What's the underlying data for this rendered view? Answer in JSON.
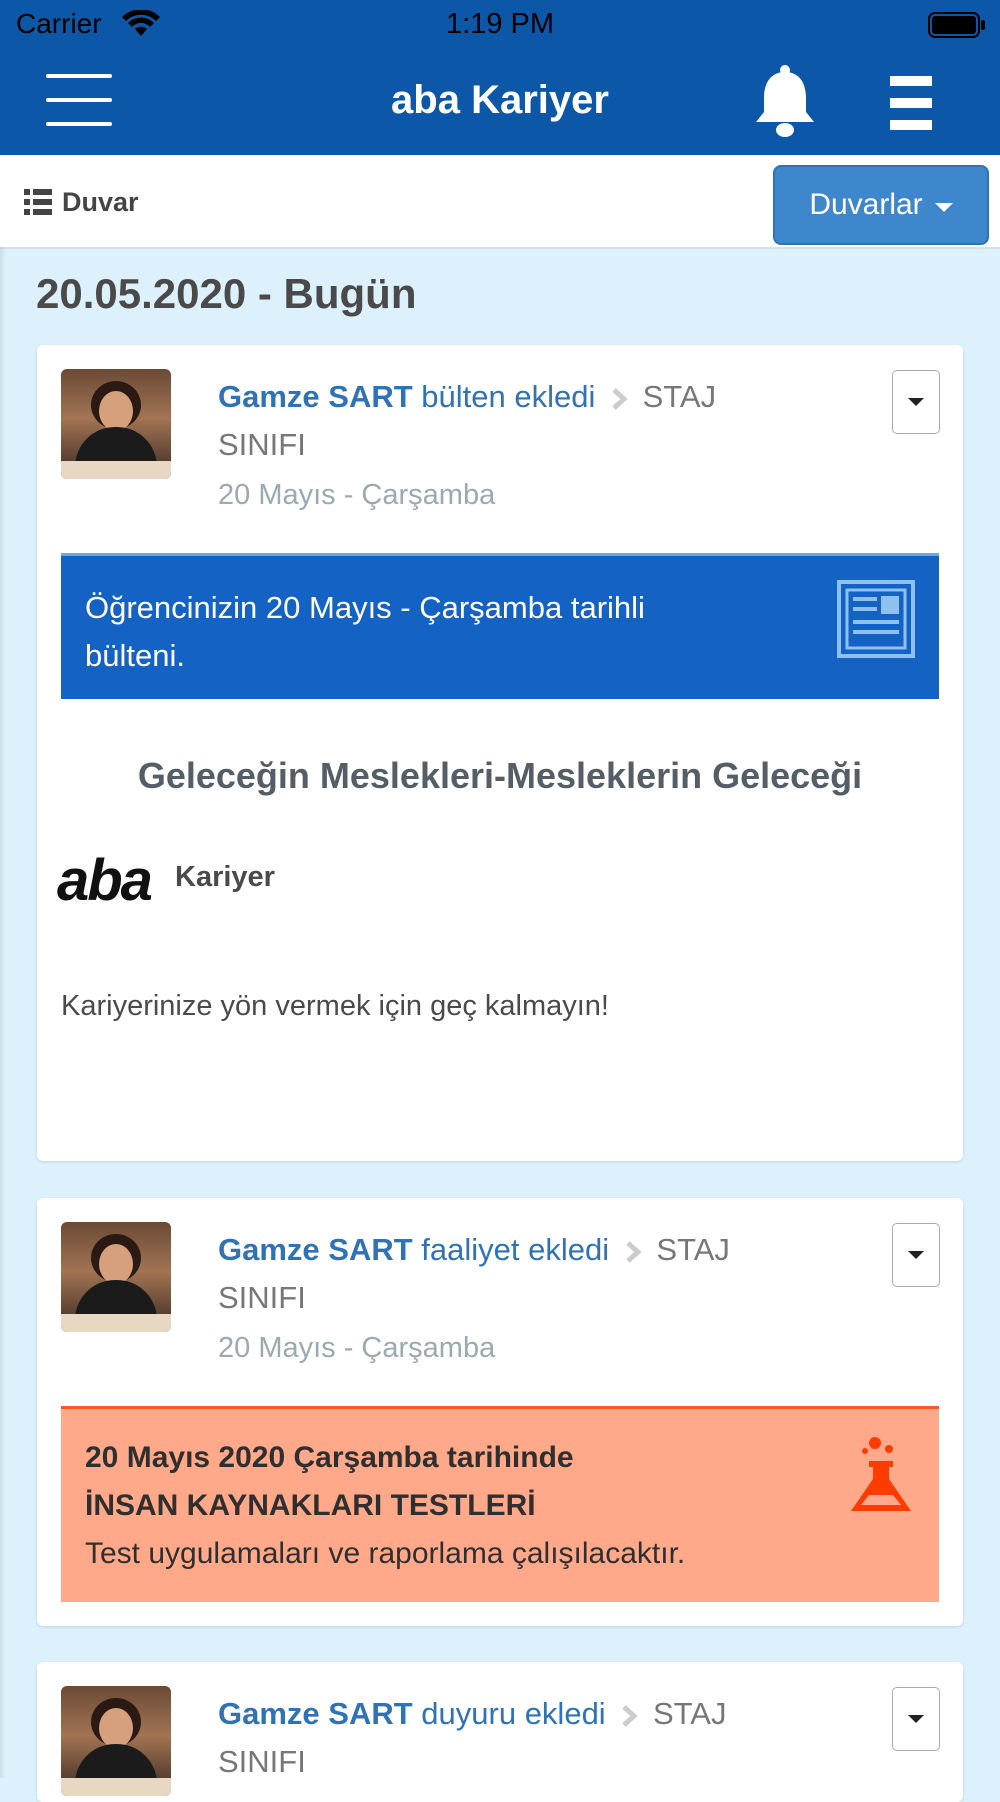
{
  "status_bar": {
    "carrier": "Carrier",
    "time": "1:19 PM"
  },
  "header": {
    "title": "aba Kariyer"
  },
  "toolbar": {
    "label": "Duvar",
    "walls_button": "Duvarlar"
  },
  "date_heading": "20.05.2020 - Bugün",
  "posts": [
    {
      "author": "Gamze SART",
      "action": "bülten ekledi",
      "target": "STAJ SINIFI",
      "date": "20 Mayıs - Çarşamba",
      "banner_text": "Öğrencinizin 20 Mayıs - Çarşamba tarihli bülteni.",
      "newsletter_title": "Geleceğin Meslekleri-Mesleklerin Geleceği",
      "logo_text": "aba",
      "logo_suffix": "Kariyer",
      "body": "Kariyerinize yön vermek için geç kalmayın!"
    },
    {
      "author": "Gamze SART",
      "action": "faaliyet ekledi",
      "target": "STAJ SINIFI",
      "date": "20 Mayıs - Çarşamba",
      "banner_line1": "20 Mayıs 2020 Çarşamba tarihinde",
      "banner_line2": "İNSAN KAYNAKLARI TESTLERİ",
      "banner_line3": "Test uygulamaları ve raporlama çalışılacaktır."
    },
    {
      "author": "Gamze SART",
      "action": "duyuru ekledi",
      "target": "STAJ SINIFI"
    }
  ],
  "icons": [
    "wifi-icon",
    "battery-icon",
    "hamburger-icon",
    "bell-icon",
    "menu-icon",
    "list-icon",
    "chevron-right-icon",
    "newspaper-icon",
    "flask-icon",
    "caret-down-icon"
  ],
  "colors": {
    "header_bg": "#0d57a8",
    "page_bg": "#dcf1fb",
    "link": "#2f73b6",
    "bulletin_bg": "#1462c4",
    "activity_bg": "#ffa98a",
    "activity_border": "#ff5722",
    "button_bg": "#3f87cc"
  }
}
